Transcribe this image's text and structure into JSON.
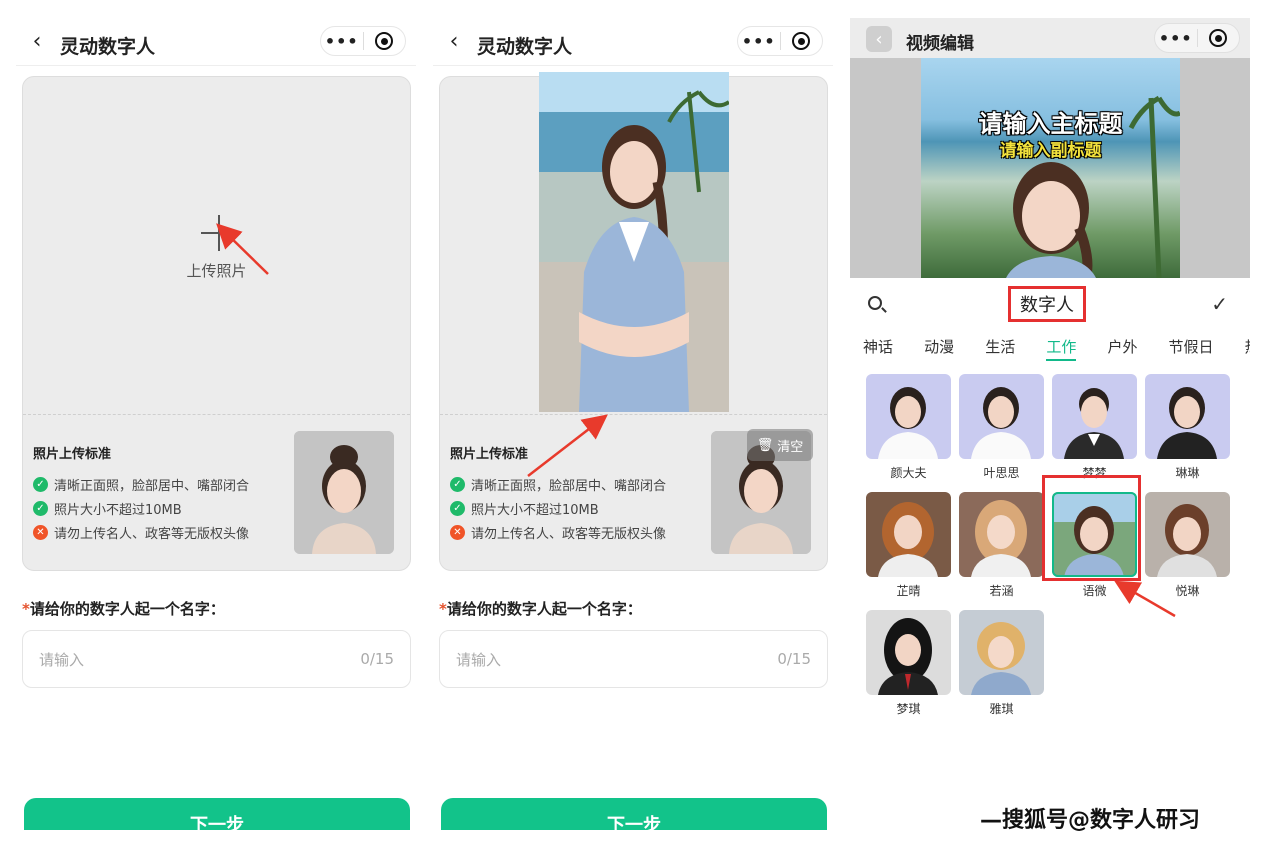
{
  "screen1": {
    "title": "灵动数字人",
    "upload_label": "上传照片",
    "standards_title": "照片上传标准",
    "standards": [
      {
        "type": "ok",
        "text": "清晰正面照，脸部居中、嘴部闭合"
      },
      {
        "type": "ok",
        "text": "照片大小不超过10MB"
      },
      {
        "type": "no",
        "text": "请勿上传名人、政客等无版权头像"
      }
    ],
    "name_label": "请给你的数字人起一个名字：",
    "name_placeholder": "请输入",
    "name_count": "0/15",
    "next_label": "下一步"
  },
  "screen2": {
    "title": "灵动数字人",
    "clear_label": "清空",
    "standards_title": "照片上传标准",
    "standards": [
      {
        "type": "ok",
        "text": "清晰正面照，脸部居中、嘴部闭合"
      },
      {
        "type": "ok",
        "text": "照片大小不超过10MB"
      },
      {
        "type": "no",
        "text": "请勿上传名人、政客等无版权头像"
      }
    ],
    "name_label": "请给你的数字人起一个名字：",
    "name_placeholder": "请输入",
    "name_count": "0/15",
    "next_label": "下一步"
  },
  "screen3": {
    "title": "视频编辑",
    "preview_main_title": "请输入主标题",
    "preview_sub_title": "请输入副标题",
    "search_value": "数字人",
    "tabs": [
      {
        "label": "神话"
      },
      {
        "label": "动漫"
      },
      {
        "label": "生活"
      },
      {
        "label": "工作",
        "active": true
      },
      {
        "label": "户外"
      },
      {
        "label": "节假日"
      },
      {
        "label": "热门"
      }
    ],
    "avatars": [
      {
        "name": "颜大夫"
      },
      {
        "name": "叶思思"
      },
      {
        "name": "梦梦"
      },
      {
        "name": "琳琳"
      },
      {
        "name": "芷晴"
      },
      {
        "name": "若涵"
      },
      {
        "name": "语微",
        "selected": true
      },
      {
        "name": "悦琳"
      },
      {
        "name": "梦琪"
      },
      {
        "name": "雅琪"
      }
    ]
  },
  "watermark": "—搜狐号@数字人研习",
  "colors": {
    "accent_green": "#12c38a",
    "highlight_red": "#e53030",
    "ok_green": "#1fba6a",
    "warn_orange": "#f05428"
  },
  "icons": [
    "back-chevron-icon",
    "more-dots-icon",
    "target-icon",
    "plus-icon",
    "check-circle-icon",
    "x-circle-icon",
    "trash-icon",
    "search-icon",
    "checkmark-icon"
  ]
}
